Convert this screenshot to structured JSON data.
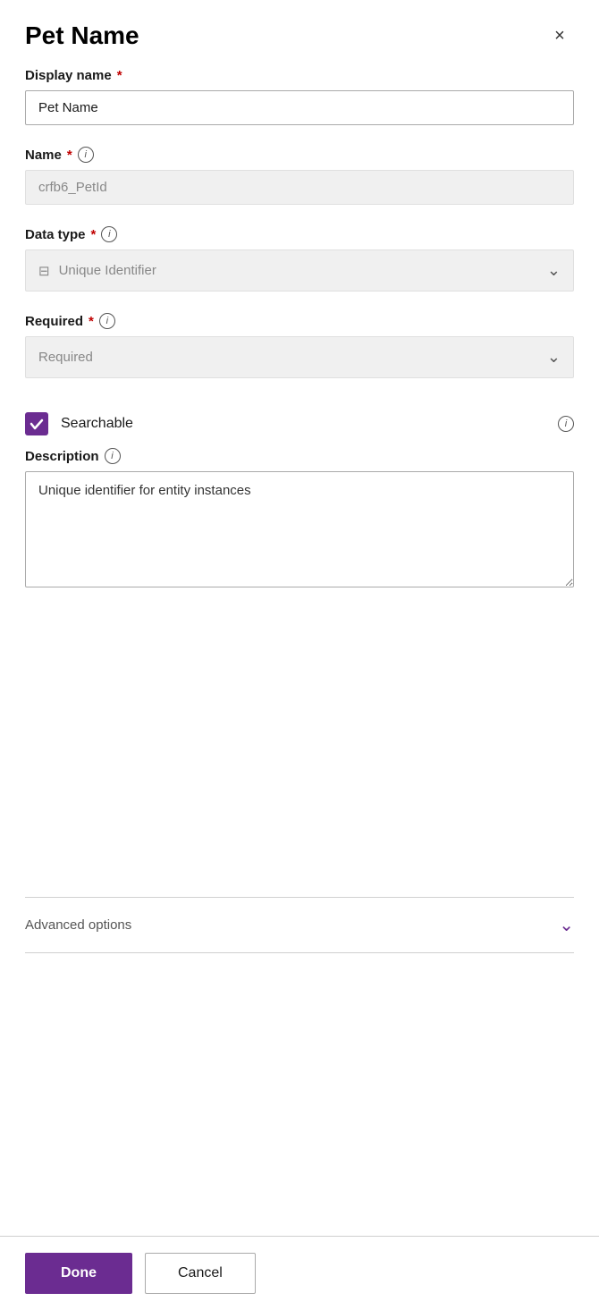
{
  "panel": {
    "title": "Pet Name",
    "close_label": "×"
  },
  "display_name_field": {
    "label": "Display name",
    "required": true,
    "value": "Pet Name",
    "placeholder": "Display name"
  },
  "name_field": {
    "label": "Name",
    "required": true,
    "value": "crfb6_PetId",
    "readonly": true
  },
  "data_type_field": {
    "label": "Data type",
    "required": true,
    "value": "Unique Identifier",
    "icon": "⊟"
  },
  "required_field": {
    "label": "Required",
    "required": true,
    "value": "Required"
  },
  "searchable_field": {
    "label": "Searchable",
    "checked": true
  },
  "description_field": {
    "label": "Description",
    "value": "Unique identifier for entity instances"
  },
  "advanced_options": {
    "label": "Advanced options"
  },
  "footer": {
    "done_label": "Done",
    "cancel_label": "Cancel"
  },
  "icons": {
    "info": "i",
    "chevron_down": "∨",
    "close": "×"
  }
}
